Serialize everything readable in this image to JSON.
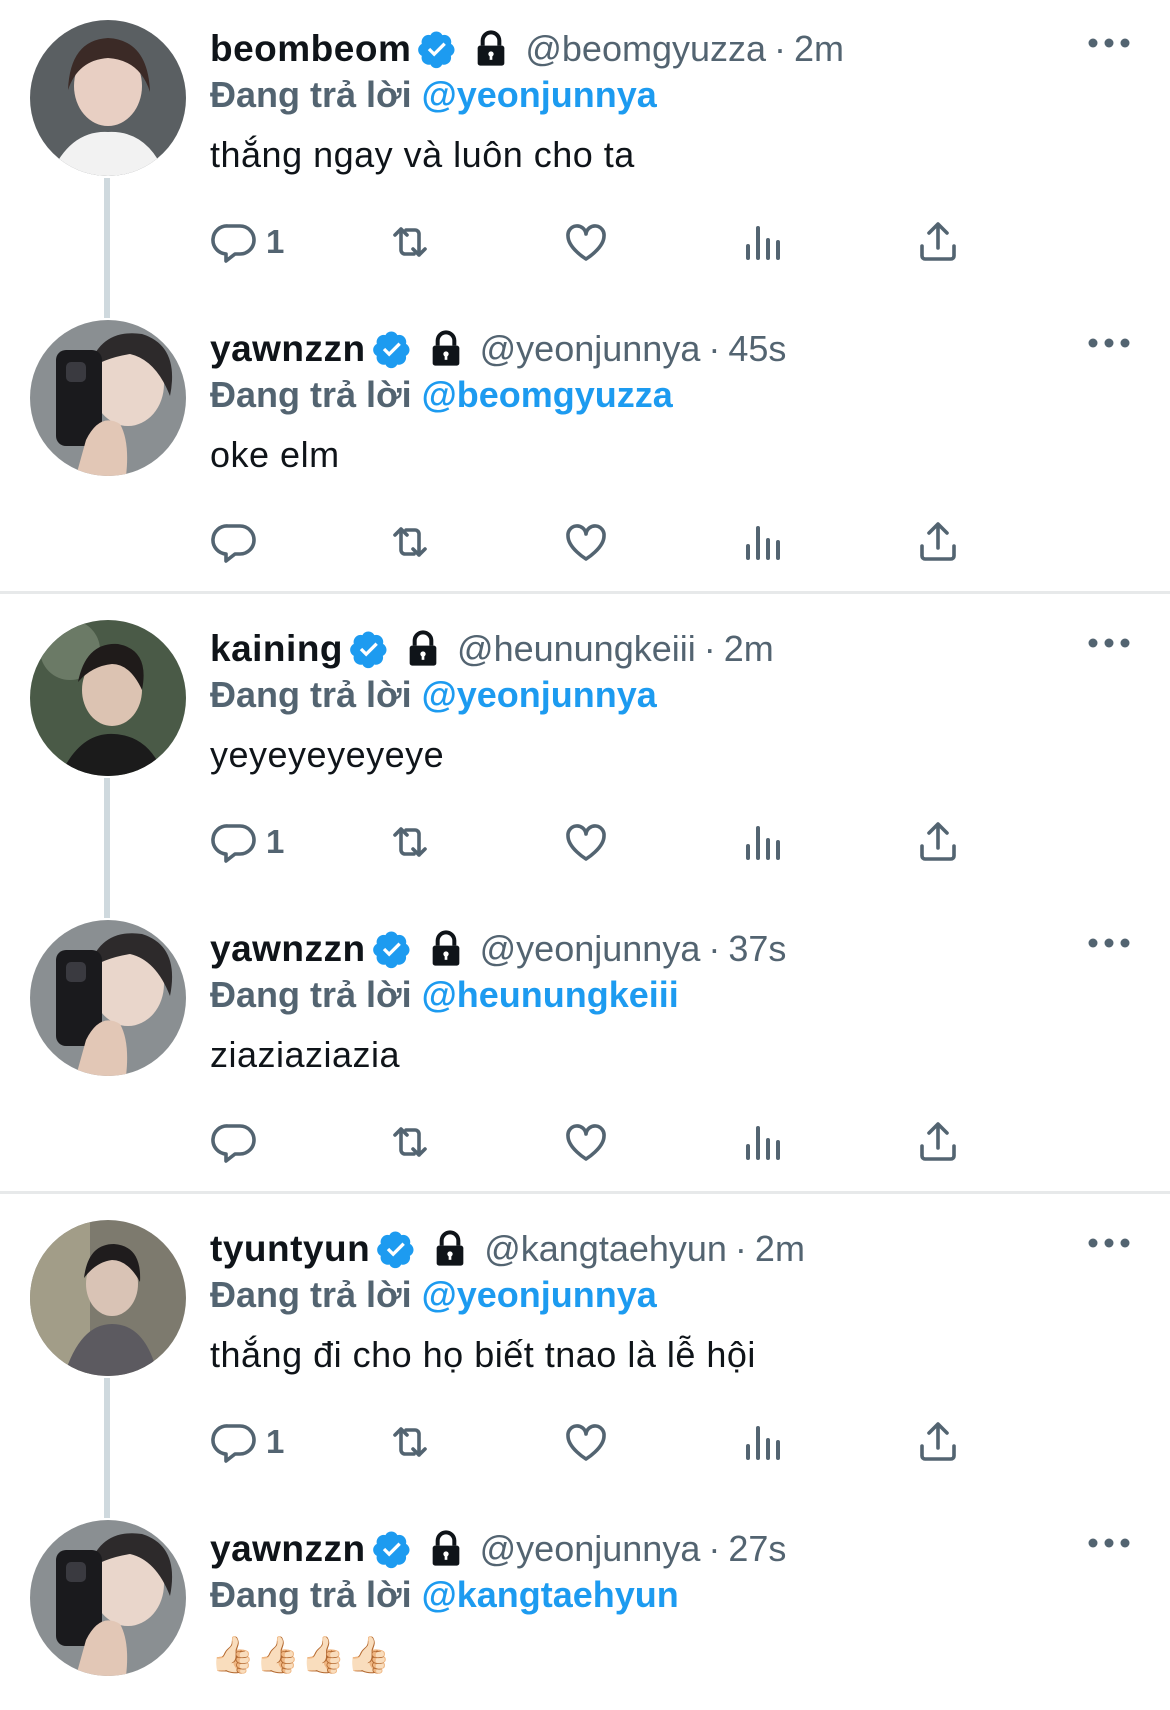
{
  "colors": {
    "accent": "#1d9bf0",
    "muted": "#536471",
    "text": "#0f1419",
    "thread_line": "#cfd9de",
    "divider": "#e7e9ea"
  },
  "replying_label": "Đang trả lời",
  "tweets": [
    {
      "name": "beombeom",
      "handle": "@beomgyuzza",
      "sep": "·",
      "time": "2m",
      "replying_to": "@yeonjunnya",
      "text": "thắng ngay và luôn cho ta",
      "reply_count": "1"
    },
    {
      "name": "yawnzzn",
      "handle": "@yeonjunnya",
      "sep": "·",
      "time": "45s",
      "replying_to": "@beomgyuzza",
      "text": "oke elm",
      "reply_count": ""
    },
    {
      "name": "kaining",
      "handle": "@heunungkeiii",
      "sep": "·",
      "time": "2m",
      "replying_to": "@yeonjunnya",
      "text": "yeyeyeyeyeye",
      "reply_count": "1"
    },
    {
      "name": "yawnzzn",
      "handle": "@yeonjunnya",
      "sep": "·",
      "time": "37s",
      "replying_to": "@heunungkeiii",
      "text": "ziaziaziazia",
      "reply_count": ""
    },
    {
      "name": "tyuntyun",
      "handle": "@kangtaehyun",
      "sep": "·",
      "time": "2m",
      "replying_to": "@yeonjunnya",
      "text": "thắng đi cho họ biết tnao là lễ hội",
      "reply_count": "1"
    },
    {
      "name": "yawnzzn",
      "handle": "@yeonjunnya",
      "sep": "·",
      "time": "27s",
      "replying_to": "@kangtaehyun",
      "text": "👍🏻👍🏻👍🏻👍🏻",
      "reply_count": ""
    }
  ],
  "icons": [
    "verified-badge-icon",
    "lock-icon",
    "more-icon",
    "reply-icon",
    "retweet-icon",
    "like-icon",
    "views-icon",
    "share-icon"
  ]
}
